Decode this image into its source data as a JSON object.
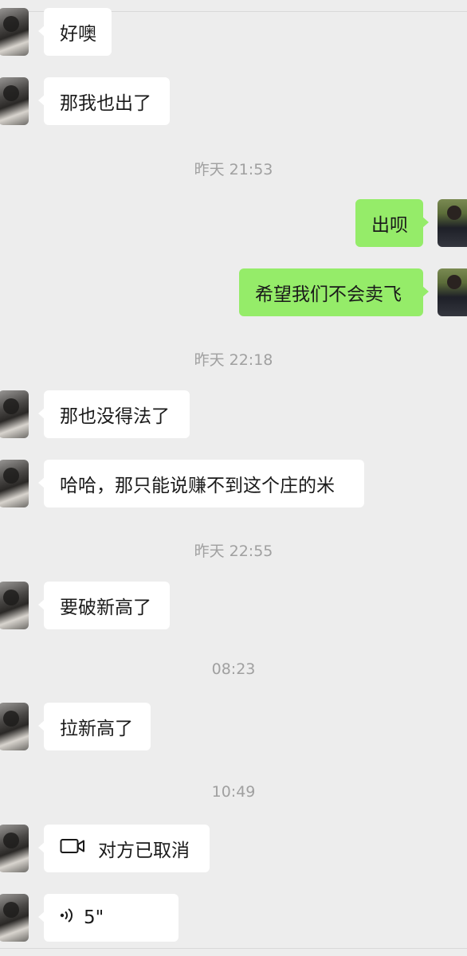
{
  "messages": [
    {
      "type": "in",
      "text": "好噢"
    },
    {
      "type": "in",
      "text": "那我也出了"
    },
    {
      "type": "time",
      "text": "昨天 21:53"
    },
    {
      "type": "out",
      "text": "出呗"
    },
    {
      "type": "out",
      "text": "希望我们不会卖飞"
    },
    {
      "type": "time",
      "text": "昨天 22:18"
    },
    {
      "type": "in",
      "text": "那也没得法了"
    },
    {
      "type": "in",
      "text": "哈哈，那只能说赚不到这个庄的米"
    },
    {
      "type": "time",
      "text": "昨天 22:55"
    },
    {
      "type": "in",
      "text": "要破新高了"
    },
    {
      "type": "time",
      "text": "08:23"
    },
    {
      "type": "in",
      "text": "拉新高了"
    },
    {
      "type": "time",
      "text": "10:49"
    },
    {
      "type": "call",
      "icon": "video-camera-icon",
      "text": "对方已取消"
    },
    {
      "type": "voice",
      "icon": "voice-wave-icon",
      "text": "5\""
    }
  ],
  "colors": {
    "background": "#ededed",
    "incoming_bubble": "#ffffff",
    "outgoing_bubble": "#95ec69",
    "timestamp_text": "#a0a0a0"
  }
}
